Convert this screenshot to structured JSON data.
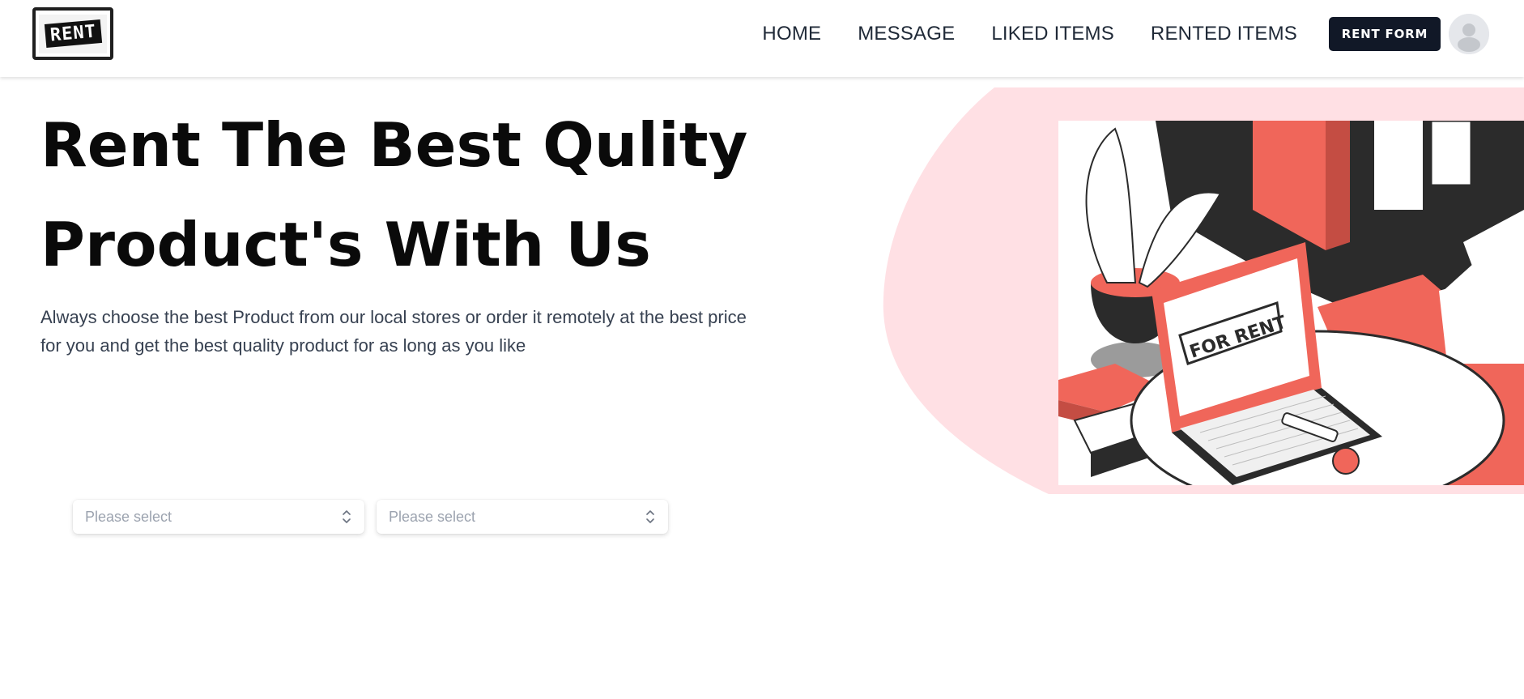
{
  "header": {
    "logo_text": "RENT",
    "nav": [
      "HOME",
      "MESSAGE",
      "LIKED ITEMS",
      "RENTED ITEMS"
    ],
    "rent_form_label": "RENT FORM"
  },
  "hero": {
    "title_line1": "Rent The Best Qulity",
    "title_line2": "Product's With Us",
    "description": "Always choose the best Product from our local stores or order it remotely at the best price for you and get the best quality product for as long as you like"
  },
  "selects": [
    {
      "placeholder": "Please select"
    },
    {
      "placeholder": "Please select"
    }
  ],
  "illustration": {
    "sign_text": "FOR RENT"
  },
  "colors": {
    "accent": "#111827",
    "blob": "#ffe0e4",
    "coral": "#f0665a",
    "dark": "#2b2b2b"
  }
}
